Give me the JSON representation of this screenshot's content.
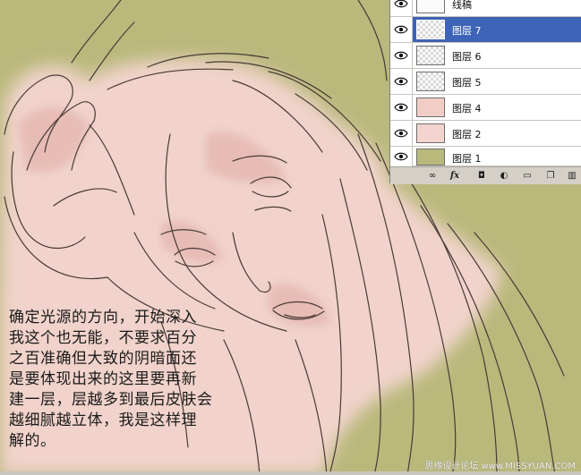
{
  "tutorial": {
    "lines": [
      "确定光源的方向，开始深入",
      "我这个也无能，不要求百分",
      "之百准确但大致的阴暗面还",
      "是要体现出来的这里要再新",
      "建一层，层越多到最后皮肤会",
      "越细腻越立体，我是这样理",
      "解的。"
    ]
  },
  "watermark": "思缘设计论坛 www.MISSYUAN.COM",
  "layers": [
    {
      "name": "线稿",
      "thumb": "line",
      "selected": false,
      "visible": true
    },
    {
      "name": "图层 7",
      "thumb": "transparent",
      "selected": true,
      "visible": true
    },
    {
      "name": "图层 6",
      "thumb": "transparent",
      "selected": false,
      "visible": true
    },
    {
      "name": "图层 5",
      "thumb": "transparent",
      "selected": false,
      "visible": true
    },
    {
      "name": "图层 4",
      "thumb": "skin2",
      "selected": false,
      "visible": true
    },
    {
      "name": "图层 2",
      "thumb": "skin",
      "selected": false,
      "visible": true
    },
    {
      "name": "图层 1",
      "thumb": "solid",
      "selected": false,
      "visible": true
    }
  ],
  "toolbar": {
    "buttons": [
      {
        "icon": "link-icon",
        "glyph": "∞"
      },
      {
        "icon": "fx-icon",
        "glyph": "fx"
      },
      {
        "icon": "mask-icon",
        "glyph": "◘"
      },
      {
        "icon": "adjustment-icon",
        "glyph": "◐"
      },
      {
        "icon": "folder-icon",
        "glyph": "▭"
      },
      {
        "icon": "new-layer-icon",
        "glyph": "❐"
      },
      {
        "icon": "trash-icon",
        "glyph": "▥"
      }
    ]
  },
  "colors": {
    "background": "#b9b97c",
    "skin": "#f0cfc6",
    "line": "#4a3a36",
    "selection": "#3e64b7"
  }
}
